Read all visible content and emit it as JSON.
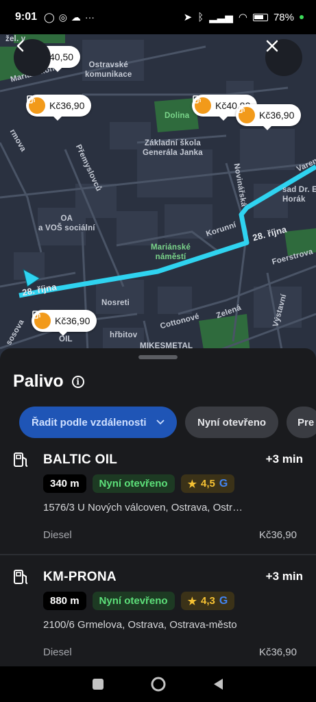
{
  "status": {
    "time": "9:01",
    "battery": "78%"
  },
  "map": {
    "labels": {
      "ostravske": "Ostravské\nkomunikace",
      "mariansko": "Mariánskohorsk",
      "zel": "žel. v",
      "dolina": "Dolina",
      "zakladni": "Základní škola\nGenerála Janka",
      "premyslovcu": "Přemyslovců",
      "oa": "OA\na VOŠ sociální",
      "novinarska": "Novinářská",
      "korunni": "Korunní",
      "namesti": "Mariánské\nnáměstí",
      "rijna1": "28. října",
      "rijna2": "28. října",
      "nosreti": "Nosreti",
      "hrbitov": "hřbitov",
      "cottonove": "Cottonové",
      "zelena": "Zelená",
      "foerstrova": "Foerstrova",
      "vystavni": "Výstavní",
      "sad": "sad Dr. E\nHorák",
      "mikesmetal": "MIKESMETAL",
      "oil": "OIL",
      "varen": "Varen",
      "rmova": "rmova",
      "sosova": "sosova"
    },
    "pins": [
      {
        "price": "40,50"
      },
      {
        "price": "Kč36,90"
      },
      {
        "price": "Kč40,90"
      },
      {
        "price": "Kč36,90"
      },
      {
        "price": "Kč36,90"
      }
    ],
    "back_icon": "chevron-left-icon",
    "close_icon": "close-icon"
  },
  "sheet": {
    "title": "Palivo",
    "info_icon": "info-icon",
    "chips": [
      {
        "label": "Řadit podle vzdálenosti"
      },
      {
        "label": "Nyní otevřeno"
      },
      {
        "label": "Pre"
      }
    ],
    "stations": [
      {
        "name": "BALTIC OIL",
        "eta": "+3 min",
        "distance": "340 m",
        "open": "Nyní otevřeno",
        "rating": "4,5",
        "address": "1576/3 U Nových válcoven, Ostrava, Ostr…",
        "fuel": "Diesel",
        "price": "Kč36,90"
      },
      {
        "name": "KM-PRONA",
        "eta": "+3 min",
        "distance": "880 m",
        "open": "Nyní otevřeno",
        "rating": "4,3",
        "address": "2100/6 Grmelova, Ostrava, Ostrava-město",
        "fuel": "Diesel",
        "price": "Kč36,90"
      }
    ]
  },
  "colors": {
    "route": "#2fd3f0",
    "accent_blue": "#1f55b6",
    "fuel_orange": "#f29a1a",
    "open_green": "#5de07a",
    "star": "#f6c233"
  }
}
